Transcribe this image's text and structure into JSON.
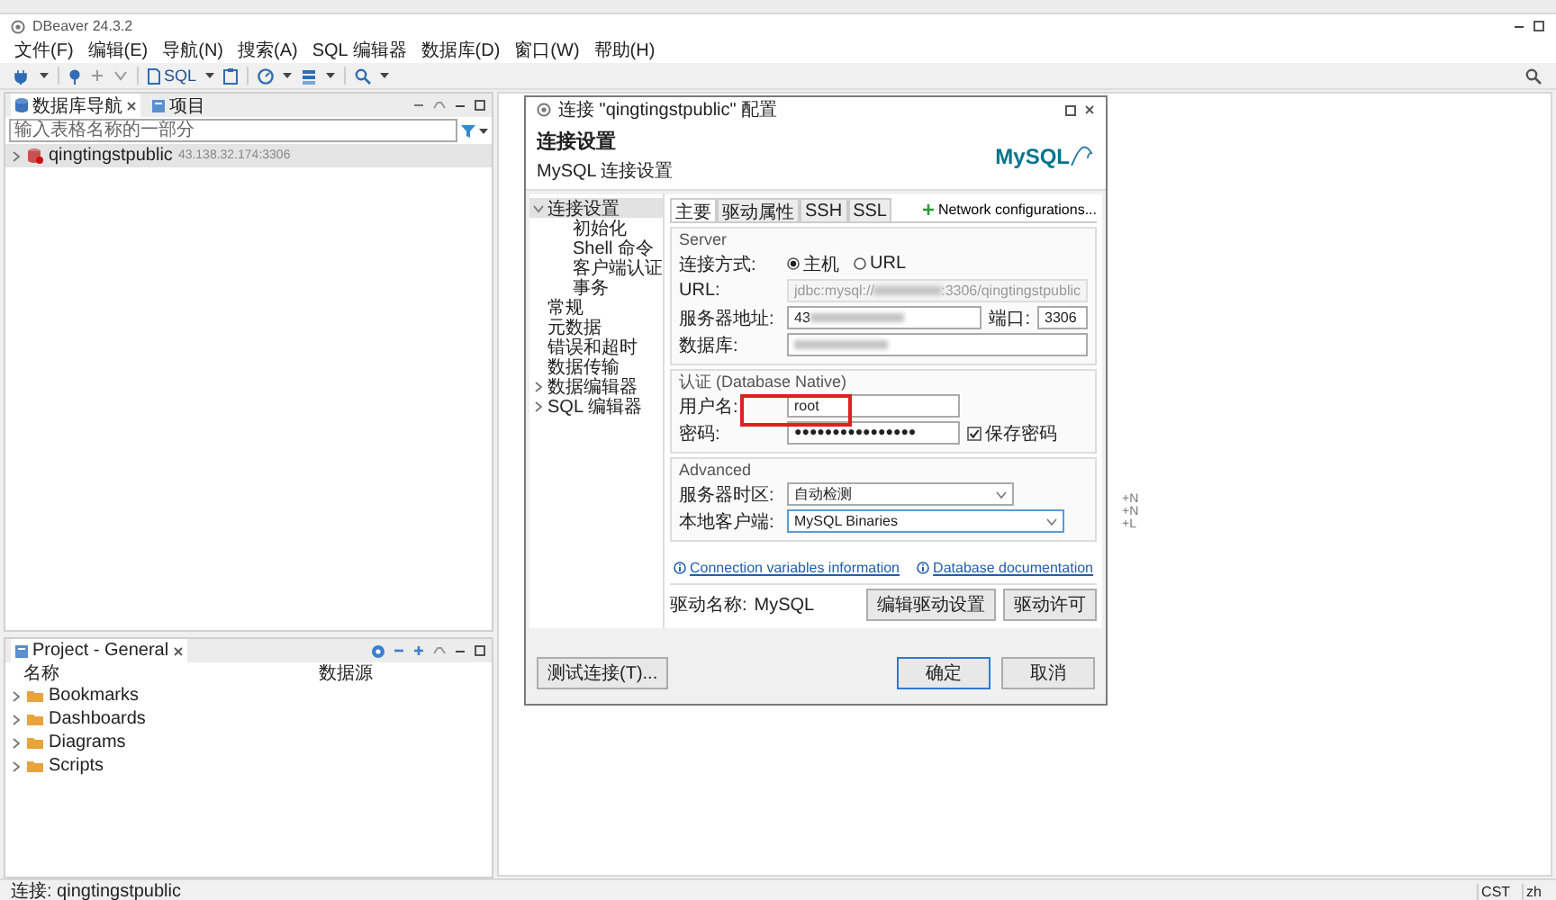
{
  "app": {
    "title": "DBeaver 24.3.2"
  },
  "menu": [
    "文件(F)",
    "编辑(E)",
    "导航(N)",
    "搜索(A)",
    "SQL 编辑器",
    "数据库(D)",
    "窗口(W)",
    "帮助(H)"
  ],
  "toolbar": {
    "sql_label": "SQL"
  },
  "navigator": {
    "tabs": [
      {
        "label": "数据库导航",
        "selected": true
      },
      {
        "label": "项目",
        "selected": false
      }
    ],
    "filter": {
      "placeholder": "输入表格名称的一部分"
    },
    "connections": [
      {
        "name": "qingtingstpublic",
        "address": "43.138.32.174:3306",
        "selected": true,
        "expanded": false
      }
    ]
  },
  "project": {
    "title": "Project - General",
    "columns": [
      "名称",
      "数据源"
    ],
    "items": [
      {
        "name": "Bookmarks",
        "expanded": false
      },
      {
        "name": "Dashboards",
        "expanded": false
      },
      {
        "name": "Diagrams",
        "expanded": false
      },
      {
        "name": "Scripts",
        "expanded": false
      }
    ]
  },
  "hints": [
    "+N",
    "+N",
    "+L"
  ],
  "dialog": {
    "title": "连接 \"qingtingstpublic\" 配置",
    "heading": "连接设置",
    "subheading": "MySQL 连接设置",
    "logo": "MySQL",
    "nav": [
      {
        "label": "连接设置",
        "selected": true,
        "expanded": true,
        "children": [
          {
            "label": "初始化",
            "selected": false
          },
          {
            "label": "Shell 命令",
            "selected": false
          },
          {
            "label": "客户端认证",
            "selected": false
          },
          {
            "label": "事务",
            "selected": false
          }
        ]
      },
      {
        "label": "常规",
        "selected": false
      },
      {
        "label": "元数据",
        "selected": false
      },
      {
        "label": "错误和超时",
        "selected": false
      },
      {
        "label": "数据传输",
        "selected": false
      },
      {
        "label": "数据编辑器",
        "selected": false,
        "expanded": false
      },
      {
        "label": "SQL 编辑器",
        "selected": false,
        "expanded": false
      }
    ],
    "tabs": [
      {
        "label": "主要",
        "selected": true
      },
      {
        "label": "驱动属性",
        "selected": false
      },
      {
        "label": "SSH",
        "selected": false
      },
      {
        "label": "SSL",
        "selected": false
      }
    ],
    "network_link": "Network configurations...",
    "server": {
      "title": "Server",
      "mode_label": "连接方式:",
      "modes": [
        {
          "label": "主机",
          "selected": true
        },
        {
          "label": "URL",
          "selected": false
        }
      ],
      "url_label": "URL:",
      "url_start": "jdbc:mysql://",
      "url_end": ":3306/qingtingstpublic",
      "host_label": "服务器地址:",
      "host": "43",
      "port_label": "端口:",
      "port": "3306",
      "database_label": "数据库:"
    },
    "auth": {
      "title": "认证 (Database Native)",
      "user_label": "用户名:",
      "user": "root",
      "password_label": "密码:",
      "password": "●●●●●●●●●●●●●●●●",
      "save_password": {
        "label": "保存密码",
        "checked": true
      }
    },
    "advanced": {
      "title": "Advanced",
      "timezone_label": "服务器时区:",
      "timezone": "自动检测",
      "client_label": "本地客户端:",
      "client": "MySQL Binaries"
    },
    "links": [
      "Connection variables information",
      "Database documentation"
    ],
    "driver": {
      "label": "驱动名称:",
      "name": "MySQL",
      "buttons": [
        "编辑驱动设置",
        "驱动许可"
      ]
    },
    "footer": {
      "test_button": "测试连接(T)...",
      "buttons": [
        {
          "label": "确定",
          "default": true
        },
        {
          "label": "取消",
          "default": false
        }
      ]
    }
  },
  "status_bar": {
    "connection": "连接: qingtingstpublic",
    "timezone": "CST",
    "locale": "zh"
  }
}
